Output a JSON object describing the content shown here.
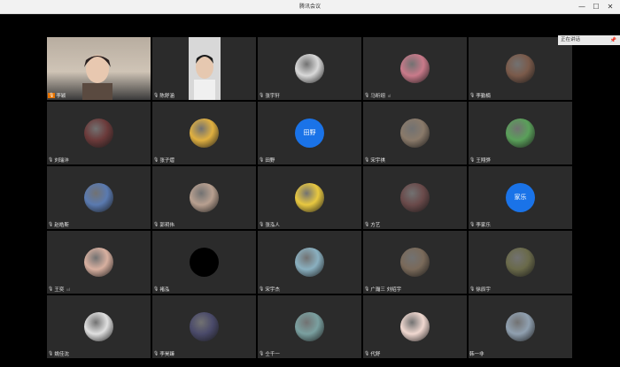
{
  "window": {
    "title": "腾讯会议",
    "minimize": "—",
    "maximize": "☐",
    "close": "✕"
  },
  "sidebar": {
    "label": "正在讲话",
    "pin": "📌"
  },
  "participants": [
    {
      "name": "李颖",
      "kind": "video",
      "mic": "muted"
    },
    {
      "name": "陈舒涵",
      "kind": "video",
      "mic": "on"
    },
    {
      "name": "张宇轩",
      "kind": "avatar",
      "color": "#d9d9d9",
      "mic": "on"
    },
    {
      "name": "马昕翊",
      "kind": "avatar",
      "color": "#c97a8a",
      "mic": "on",
      "signal": "ııl"
    },
    {
      "name": "李勤楠",
      "kind": "avatar",
      "color": "#7a5a4a",
      "mic": "on"
    },
    {
      "name": "刘瑞沣",
      "kind": "avatar",
      "color": "#6b3a3a",
      "mic": "on"
    },
    {
      "name": "张子熠",
      "kind": "avatar",
      "color": "#e0b040",
      "mic": "on"
    },
    {
      "name": "田野",
      "kind": "initial",
      "initial": "田野",
      "mic": "on"
    },
    {
      "name": "宋宇祺",
      "kind": "avatar",
      "color": "#8a7a6a",
      "mic": "on"
    },
    {
      "name": "王翔骅",
      "kind": "avatar",
      "color": "#5aa05a",
      "mic": "on"
    },
    {
      "name": "赵皓斯",
      "kind": "avatar",
      "color": "#5a7ab0",
      "mic": "on"
    },
    {
      "name": "郭玥伟",
      "kind": "avatar",
      "color": "#b8a090",
      "mic": "on"
    },
    {
      "name": "张泓人",
      "kind": "avatar",
      "color": "#e8c840",
      "mic": "on"
    },
    {
      "name": "方艺",
      "kind": "avatar",
      "color": "#6a4a4a",
      "mic": "on"
    },
    {
      "name": "李家乐",
      "kind": "initial",
      "initial": "家乐",
      "mic": "on"
    },
    {
      "name": "王奕",
      "kind": "avatar",
      "color": "#d8b0a0",
      "mic": "on",
      "signal": "ııl"
    },
    {
      "name": "褚泓",
      "kind": "black",
      "mic": "on"
    },
    {
      "name": "宋宇杰",
      "kind": "avatar",
      "color": "#8ab0c0",
      "mic": "on"
    },
    {
      "name": "广瀚三 刘绍宇",
      "kind": "avatar",
      "color": "#7a6a5a",
      "mic": "on"
    },
    {
      "name": "徐辰宇",
      "kind": "avatar",
      "color": "#6a6a4a",
      "mic": "on"
    },
    {
      "name": "姚佳沈",
      "kind": "avatar",
      "color": "#e0e0e0",
      "mic": "on"
    },
    {
      "name": "李昊臻",
      "kind": "avatar",
      "color": "#4a4a6a",
      "mic": "on"
    },
    {
      "name": "仝千一",
      "kind": "avatar",
      "color": "#7aa0a0",
      "mic": "on"
    },
    {
      "name": "代舒",
      "kind": "avatar",
      "color": "#f0d8d0",
      "mic": "on"
    },
    {
      "name": "韩一非",
      "kind": "avatar",
      "color": "#90a0b0",
      "mic": "none"
    }
  ]
}
